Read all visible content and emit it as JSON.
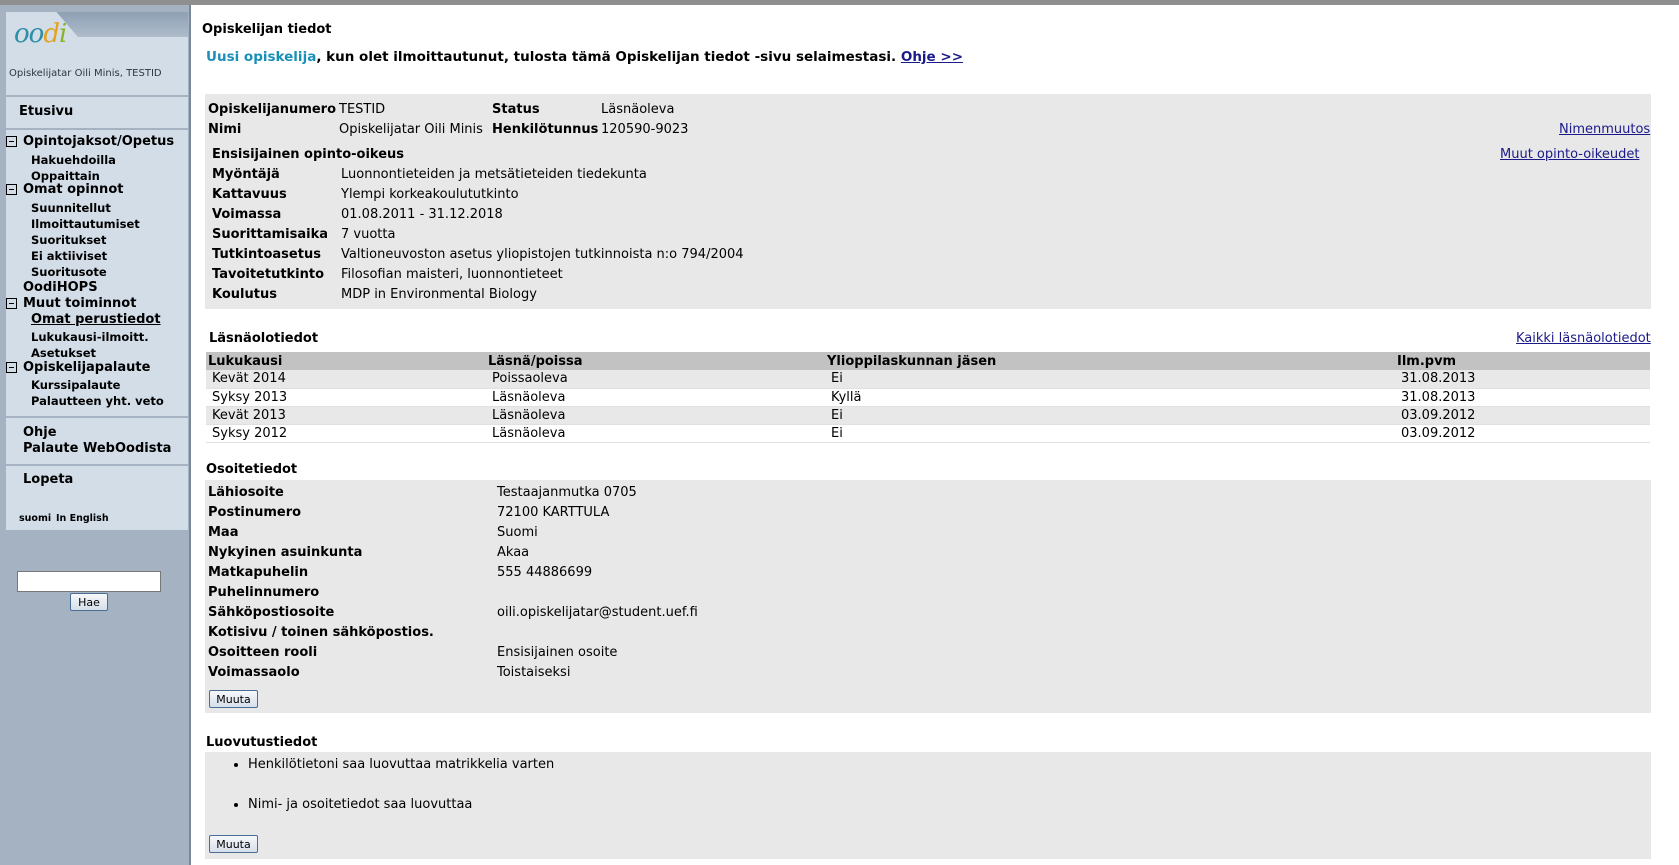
{
  "sidebar": {
    "user_name": "Opiskelijatar Oili Minis, TESTID",
    "home": "Etusivu",
    "sections": [
      {
        "label": "Opintojaksot/Opetus",
        "items": [
          "Hakuehdoilla",
          "Oppaittain"
        ]
      },
      {
        "label": "Omat opinnot",
        "items": [
          "Suunnitellut",
          "Ilmoittautumiset",
          "Suoritukset",
          "Ei aktiiviset",
          "Suoritusote"
        ]
      },
      {
        "label": "OodiHOPS"
      },
      {
        "label": "Muut toiminnot",
        "items": [
          "Omat perustiedot",
          "Lukukausi-ilmoitt.",
          "Asetukset"
        ]
      },
      {
        "label": "Opiskelijapalaute",
        "items": [
          "Kurssipalaute",
          "Palautteen yht. veto"
        ]
      }
    ],
    "help": "Ohje",
    "feedback": "Palaute WebOodista",
    "logout": "Lopeta",
    "lang_fi": "suomi",
    "lang_en": "In English",
    "search_value": "",
    "search_button": "Hae"
  },
  "main": {
    "page_title": "Opiskelijan tiedot",
    "intro_new": "Uusi opiskelija",
    "intro_text": ", kun olet ilmoittautunut, tulosta tämä Opiskelijan tiedot -sivu selaimestasi.",
    "intro_link": "Ohje >>",
    "student": {
      "number_label": "Opiskelijanumero",
      "number": "TESTID",
      "status_label": "Status",
      "status": "Läsnäoleva",
      "name_label": "Nimi",
      "name": "Opiskelijatar Oili Minis",
      "ssn_label": "Henkilötunnus",
      "ssn": "120590-9023",
      "name_change_link": "Nimenmuutos"
    },
    "right": {
      "title": "Ensisijainen opinto-oikeus",
      "other_link": "Muut opinto-oikeudet",
      "rows": [
        {
          "label": "Myöntäjä",
          "value": "Luonnontieteiden ja metsätieteiden tiedekunta"
        },
        {
          "label": "Kattavuus",
          "value": "Ylempi korkeakoulututkinto"
        },
        {
          "label": "Voimassa",
          "value": "01.08.2011 - 31.12.2018"
        },
        {
          "label": "Suorittamisaika",
          "value": "7 vuotta"
        },
        {
          "label": "Tutkintoasetus",
          "value": "Valtioneuvoston asetus yliopistojen tutkinnoista n:o 794/2004"
        },
        {
          "label": "Tavoitetutkinto",
          "value": "Filosofian maisteri, luonnontieteet"
        },
        {
          "label": "Koulutus",
          "value": "MDP in Environmental Biology"
        }
      ]
    },
    "attendance": {
      "title": "Läsnäolotiedot",
      "all_link": "Kaikki läsnäolotiedot",
      "headers": [
        "Lukukausi",
        "Läsnä/poissa",
        "Ylioppilaskunnan jäsen",
        "Ilm.pvm"
      ],
      "rows": [
        [
          "Kevät 2014",
          "Poissaoleva",
          "Ei",
          "31.08.2013"
        ],
        [
          "Syksy 2013",
          "Läsnäoleva",
          "Kyllä",
          "31.08.2013"
        ],
        [
          "Kevät 2013",
          "Läsnäoleva",
          "Ei",
          "03.09.2012"
        ],
        [
          "Syksy 2012",
          "Läsnäoleva",
          "Ei",
          "03.09.2012"
        ]
      ]
    },
    "address": {
      "title": "Osoitetiedot",
      "rows": [
        {
          "label": "Lähiosoite",
          "value": "Testaajanmutka 0705"
        },
        {
          "label": "Postinumero",
          "value": "72100 KARTTULA"
        },
        {
          "label": "Maa",
          "value": "Suomi"
        },
        {
          "label": "Nykyinen asuinkunta",
          "value": "Akaa"
        },
        {
          "label": "Matkapuhelin",
          "value": "555 44886699"
        },
        {
          "label": "Puhelinnumero",
          "value": ""
        },
        {
          "label": "Sähköpostiosoite",
          "value": "oili.opiskelijatar@student.uef.fi"
        },
        {
          "label": "Kotisivu / toinen sähköpostios.",
          "value": ""
        },
        {
          "label": "Osoitteen rooli",
          "value": "Ensisijainen osoite"
        },
        {
          "label": "Voimassaolo",
          "value": "Toistaiseksi"
        }
      ],
      "edit_button": "Muuta"
    },
    "release": {
      "title": "Luovutustiedot",
      "items": [
        "Henkilötietoni saa luovuttaa matrikkelia varten",
        "Nimi- ja osoitetiedot saa luovuttaa"
      ],
      "edit_button": "Muuta"
    }
  }
}
